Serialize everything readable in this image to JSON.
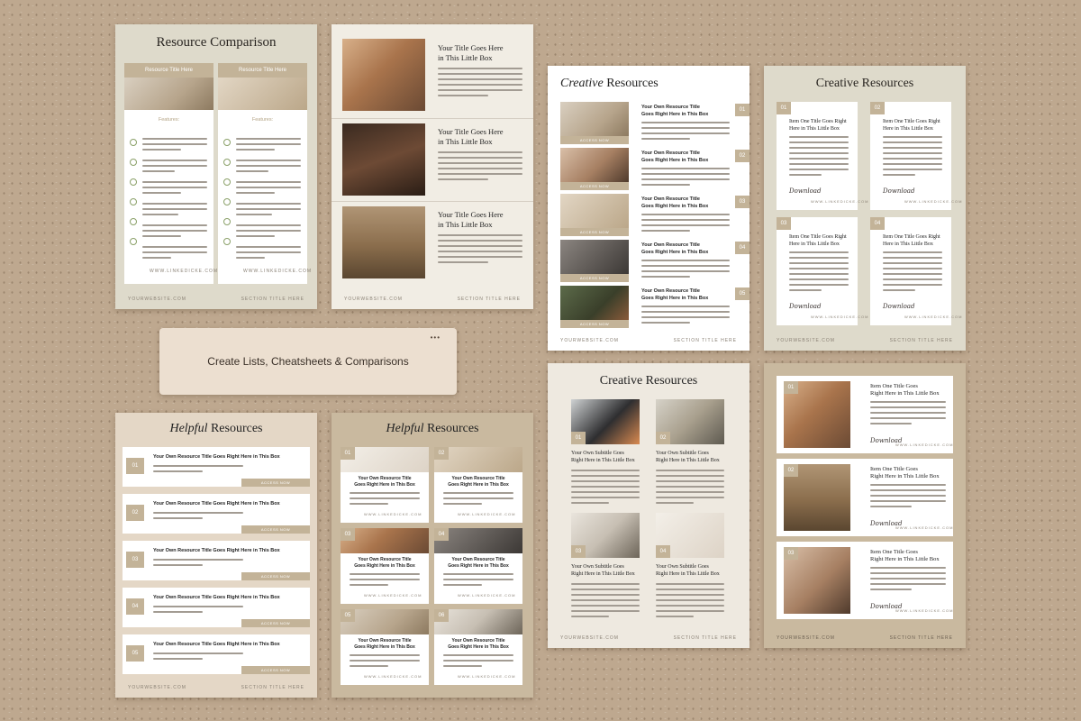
{
  "callout": {
    "text": "Create Lists, Cheatsheets & Comparisons",
    "dots": "•••"
  },
  "footer": {
    "website": "YOURWEBSITE.COM",
    "section": "SECTION TITLE HERE",
    "link": "WWW.LINKEDICKE.COM"
  },
  "p1": {
    "title": "Resource Comparison",
    "col_header": "Resource Title Here",
    "features": "Features:"
  },
  "p2": {
    "heading1": "Your Title Goes Here",
    "heading2": "in This Little Box"
  },
  "p3": {
    "title_italic": "Creative",
    "title_rest": "Resources",
    "item1": "Your Own Resource Title",
    "item2": "Goes Right Here in This Box",
    "btn": "ACCESS NOW",
    "nums": [
      "01",
      "02",
      "03",
      "04",
      "05"
    ]
  },
  "p4": {
    "title": "Creative Resources",
    "item1": "Item One Title Goes Right",
    "item2": "Here in This Little Box",
    "sig": "Download",
    "nums": [
      "01",
      "02",
      "03",
      "04"
    ]
  },
  "p5": {
    "title_italic": "Helpful",
    "title_rest": "Resources",
    "item": "Your Own Resource Title Goes Right Here in This Box",
    "btn": "ACCESS NOW",
    "nums": [
      "01",
      "02",
      "03",
      "04",
      "05"
    ]
  },
  "p6": {
    "title_italic": "Helpful",
    "title_rest": "Resources",
    "item1": "Your Own Resource Title",
    "item2": "Goes Right Here in This Box",
    "nums": [
      "01",
      "02",
      "03",
      "04",
      "05",
      "06"
    ]
  },
  "p7": {
    "title": "Creative Resources",
    "sub1": "Your Own Subtitle Goes",
    "sub2": "Right Here in This Little Box",
    "nums": [
      "01",
      "02",
      "03",
      "04"
    ]
  },
  "p8": {
    "item1": "Item One Title Goes",
    "item2": "Right Here in This Little Box",
    "sig": "Download",
    "nums": [
      "01",
      "02",
      "03"
    ]
  }
}
